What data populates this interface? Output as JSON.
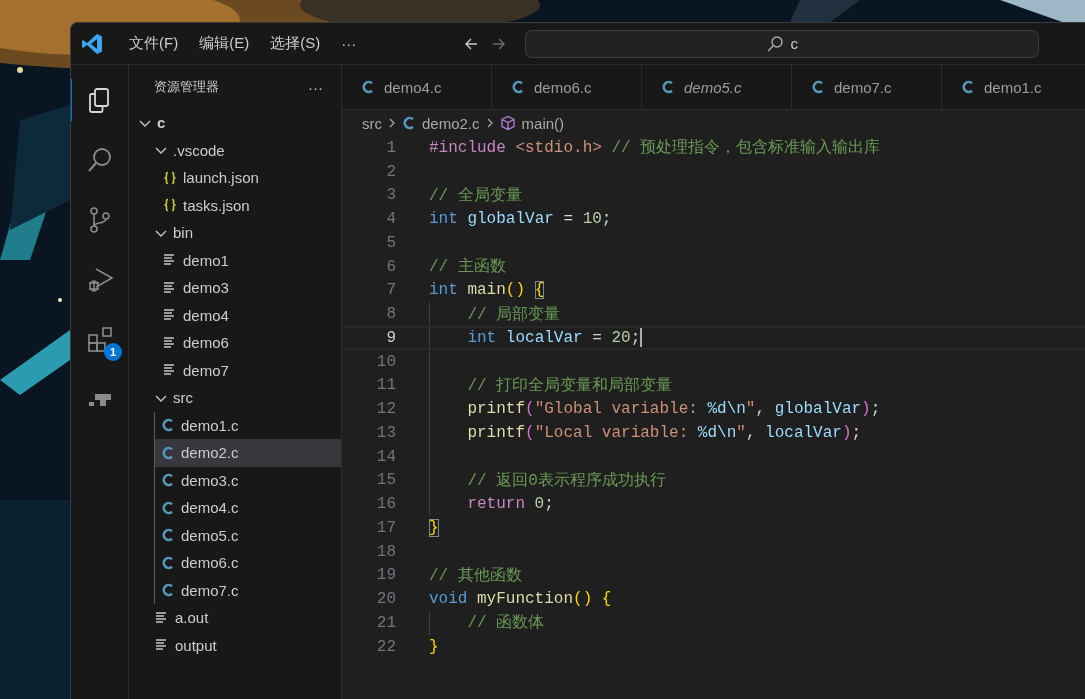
{
  "title_bar": {
    "menus": [
      "文件(F)",
      "编辑(E)",
      "选择(S)"
    ],
    "more": "···",
    "back": {
      "disabled": false
    },
    "forward": {
      "disabled": true
    },
    "search": {
      "value": "c"
    }
  },
  "activity_bar": {
    "items": [
      {
        "kind": "explorer",
        "selected": true
      },
      {
        "kind": "search",
        "selected": false
      },
      {
        "kind": "source-control",
        "selected": false
      },
      {
        "kind": "run-debug",
        "selected": false
      },
      {
        "kind": "extensions",
        "selected": false,
        "badge": "1"
      },
      {
        "kind": "remote",
        "selected": false
      }
    ]
  },
  "explorer": {
    "title": "资源管理器",
    "more": "···",
    "tree": [
      {
        "label": "c",
        "kind": "folder",
        "expanded": true,
        "selected": false,
        "children": [
          {
            "label": ".vscode",
            "kind": "folder",
            "expanded": true,
            "selected": false,
            "children": [
              {
                "label": "launch.json",
                "kind": "json",
                "selected": false
              },
              {
                "label": "tasks.json",
                "kind": "json",
                "selected": false
              }
            ]
          },
          {
            "label": "bin",
            "kind": "folder",
            "expanded": true,
            "selected": false,
            "children": [
              {
                "label": "demo1",
                "kind": "binary",
                "selected": false
              },
              {
                "label": "demo3",
                "kind": "binary",
                "selected": false
              },
              {
                "label": "demo4",
                "kind": "binary",
                "selected": false
              },
              {
                "label": "demo6",
                "kind": "binary",
                "selected": false
              },
              {
                "label": "demo7",
                "kind": "binary",
                "selected": false
              }
            ]
          },
          {
            "label": "src",
            "kind": "folder",
            "expanded": true,
            "selected": false,
            "children": [
              {
                "label": "demo1.c",
                "kind": "c",
                "selected": false
              },
              {
                "label": "demo2.c",
                "kind": "c",
                "selected": true
              },
              {
                "label": "demo3.c",
                "kind": "c",
                "selected": false
              },
              {
                "label": "demo4.c",
                "kind": "c",
                "selected": false
              },
              {
                "label": "demo5.c",
                "kind": "c",
                "selected": false
              },
              {
                "label": "demo6.c",
                "kind": "c",
                "selected": false
              },
              {
                "label": "demo7.c",
                "kind": "c",
                "selected": false
              }
            ]
          },
          {
            "label": "a.out",
            "kind": "binary",
            "selected": false
          },
          {
            "label": "output",
            "kind": "binary",
            "selected": false
          }
        ]
      }
    ]
  },
  "editor": {
    "tabs": [
      {
        "label": "demo4.c",
        "preview": false,
        "selected": false
      },
      {
        "label": "demo6.c",
        "preview": false,
        "selected": false
      },
      {
        "label": "demo5.c",
        "preview": true,
        "selected": false
      },
      {
        "label": "demo7.c",
        "preview": false,
        "selected": false
      },
      {
        "label": "demo1.c",
        "preview": false,
        "selected": false
      }
    ],
    "breadcrumbs": [
      {
        "label": "src",
        "kind": "folder"
      },
      {
        "label": "demo2.c",
        "kind": "c"
      },
      {
        "label": "main()",
        "kind": "function"
      }
    ],
    "lines": [
      {
        "number": "1",
        "current": false,
        "indent_guide": false,
        "tokens": [
          {
            "text": "#include",
            "kind": "preproc"
          },
          {
            "text": " <stdio.h>",
            "kind": "string"
          },
          {
            "text": " // 预处理指令，包含标准输入输出库",
            "kind": "comment"
          }
        ]
      },
      {
        "number": "2",
        "current": false,
        "indent_guide": false
      },
      {
        "number": "3",
        "current": false,
        "indent_guide": false,
        "tokens": [
          {
            "text": "// 全局变量",
            "kind": "comment"
          }
        ]
      },
      {
        "number": "4",
        "current": false,
        "indent_guide": false,
        "tokens": [
          {
            "text": "int",
            "kind": "keyword"
          },
          {
            "text": " globalVar",
            "kind": "variable"
          },
          {
            "text": " = ",
            "kind": "plain"
          },
          {
            "text": "10",
            "kind": "number"
          },
          {
            "text": ";",
            "kind": "plain"
          }
        ]
      },
      {
        "number": "5",
        "current": false,
        "indent_guide": false
      },
      {
        "number": "6",
        "current": false,
        "indent_guide": false,
        "tokens": [
          {
            "text": "// 主函数",
            "kind": "comment"
          }
        ]
      },
      {
        "number": "7",
        "current": false,
        "indent_guide": false,
        "tokens": [
          {
            "text": "int",
            "kind": "keyword"
          },
          {
            "text": " main",
            "kind": "function"
          },
          {
            "text": "() ",
            "kind": "bracket1"
          },
          {
            "text": "{",
            "kind": "bracket-match"
          }
        ]
      },
      {
        "number": "8",
        "current": false,
        "indent_guide": true,
        "tokens": [
          {
            "text": "    // 局部变量",
            "kind": "comment"
          }
        ]
      },
      {
        "number": "9",
        "current": true,
        "indent_guide": true,
        "tokens": [
          {
            "text": "    int",
            "kind": "keyword"
          },
          {
            "text": " localVar",
            "kind": "variable"
          },
          {
            "text": " = ",
            "kind": "plain"
          },
          {
            "text": "20",
            "kind": "number"
          },
          {
            "text": ";",
            "kind": "plain"
          }
        ]
      },
      {
        "number": "10",
        "current": false,
        "indent_guide": true
      },
      {
        "number": "11",
        "current": false,
        "indent_guide": true,
        "tokens": [
          {
            "text": "    // 打印全局变量和局部变量",
            "kind": "comment"
          }
        ]
      },
      {
        "number": "12",
        "current": false,
        "indent_guide": true,
        "tokens": [
          {
            "text": "    printf",
            "kind": "function"
          },
          {
            "text": "(",
            "kind": "bracket2"
          },
          {
            "text": "\"Global variable: ",
            "kind": "string"
          },
          {
            "text": "%d\\n",
            "kind": "escape"
          },
          {
            "text": "\"",
            "kind": "string"
          },
          {
            "text": ", ",
            "kind": "plain"
          },
          {
            "text": "globalVar",
            "kind": "variable"
          },
          {
            "text": ")",
            "kind": "bracket2"
          },
          {
            "text": ";",
            "kind": "plain"
          }
        ]
      },
      {
        "number": "13",
        "current": false,
        "indent_guide": true,
        "tokens": [
          {
            "text": "    printf",
            "kind": "function"
          },
          {
            "text": "(",
            "kind": "bracket2"
          },
          {
            "text": "\"Local variable: ",
            "kind": "string"
          },
          {
            "text": "%d\\n",
            "kind": "escape"
          },
          {
            "text": "\"",
            "kind": "string"
          },
          {
            "text": ", ",
            "kind": "plain"
          },
          {
            "text": "localVar",
            "kind": "variable"
          },
          {
            "text": ")",
            "kind": "bracket2"
          },
          {
            "text": ";",
            "kind": "plain"
          }
        ]
      },
      {
        "number": "14",
        "current": false,
        "indent_guide": true
      },
      {
        "number": "15",
        "current": false,
        "indent_guide": true,
        "tokens": [
          {
            "text": "    // 返回0表示程序成功执行",
            "kind": "comment"
          }
        ]
      },
      {
        "number": "16",
        "current": false,
        "indent_guide": true,
        "tokens": [
          {
            "text": "    return",
            "kind": "control"
          },
          {
            "text": " 0",
            "kind": "number"
          },
          {
            "text": ";",
            "kind": "plain"
          }
        ]
      },
      {
        "number": "17",
        "current": false,
        "indent_guide": false,
        "tokens": [
          {
            "text": "}",
            "kind": "bracket-match"
          }
        ]
      },
      {
        "number": "18",
        "current": false,
        "indent_guide": false
      },
      {
        "number": "19",
        "current": false,
        "indent_guide": false,
        "tokens": [
          {
            "text": "// 其他函数",
            "kind": "comment"
          }
        ]
      },
      {
        "number": "20",
        "current": false,
        "indent_guide": false,
        "tokens": [
          {
            "text": "void",
            "kind": "keyword"
          },
          {
            "text": " myFunction",
            "kind": "function"
          },
          {
            "text": "()",
            "kind": "bracket1"
          },
          {
            "text": " {",
            "kind": "bracket1"
          }
        ]
      },
      {
        "number": "21",
        "current": false,
        "indent_guide": true,
        "tokens": [
          {
            "text": "    // 函数体",
            "kind": "comment"
          }
        ]
      },
      {
        "number": "22",
        "current": false,
        "indent_guide": false,
        "tokens": [
          {
            "text": "}",
            "kind": "bracket1"
          }
        ]
      }
    ]
  }
}
